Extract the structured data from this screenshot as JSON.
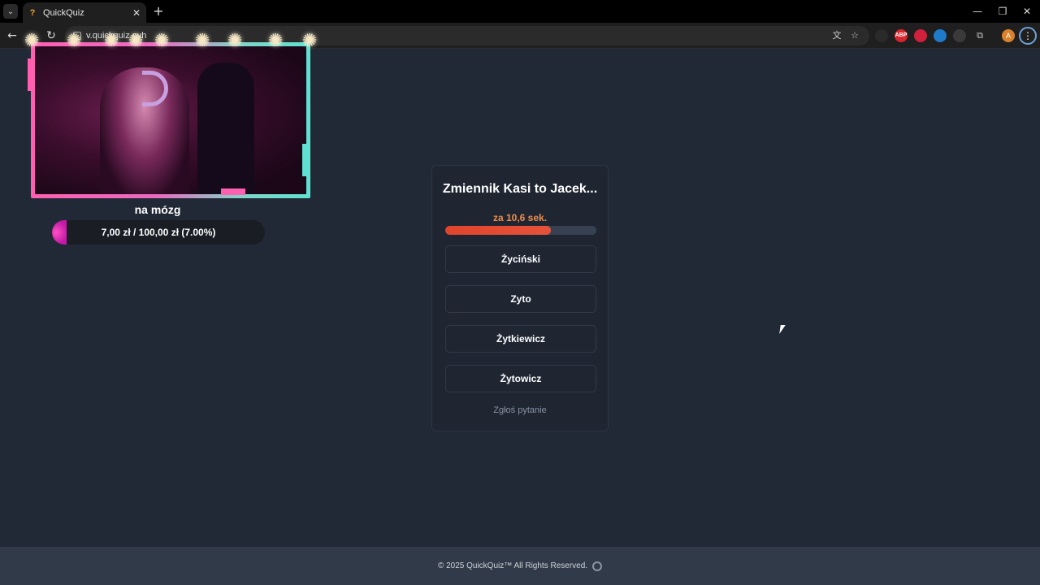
{
  "browser": {
    "tab_title": "QuickQuiz",
    "favicon": "?",
    "url": "v.quickquiz.ovh",
    "tab_close": "✕",
    "new_tab": "+",
    "tab_list": "⌄",
    "controls": {
      "minimize": "—",
      "restore": "❐",
      "close": "✕"
    },
    "nav": {
      "back": "←",
      "reload": "↻"
    },
    "toolbar_icons": {
      "translate": "文",
      "bookmark": "☆",
      "extensions": "⧉",
      "menu": "⋮"
    },
    "extensions": [
      {
        "name": "shield-ext-icon",
        "label": "",
        "color": "#2a2a2a"
      },
      {
        "name": "adblock-ext-icon",
        "label": "ABP",
        "color": "#d6262f"
      },
      {
        "name": "red-ext-icon",
        "label": "",
        "color": "#d0203c"
      },
      {
        "name": "translate-ext-icon",
        "label": "",
        "color": "#1f7ac8"
      },
      {
        "name": "grey-ext-icon",
        "label": "",
        "color": "#3a3a3a"
      }
    ],
    "avatar_letter": "A"
  },
  "stream": {
    "title": "na mózg",
    "donation_text": "7,00 zł / 100,00 zł (7.00%)",
    "donation_progress": 0.07
  },
  "quiz": {
    "question": "Zmiennik Kasi to Jacek...",
    "timer_label": "za 10,6 sek.",
    "timer_progress": 0.7,
    "answers": [
      "Życiński",
      "Zyto",
      "Żytkiewicz",
      "Żytowicz"
    ],
    "report": "Zgłoś pytanie"
  },
  "footer": {
    "text": "© 2025  QuickQuiz™ All Rights Reserved."
  },
  "colors": {
    "page_bg": "#222936",
    "timer_bar": "#e0442c",
    "timer_text": "#ef8d4c",
    "donation_fill": "#c31aa6"
  }
}
